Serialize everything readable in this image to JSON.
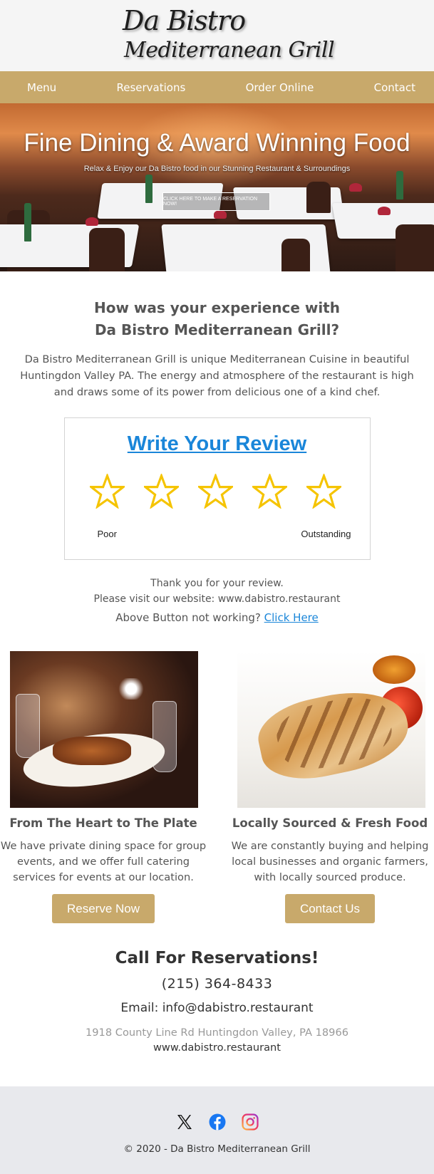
{
  "logo": {
    "line1": "Da Bistro",
    "line2": "Mediterranean Grill"
  },
  "nav": [
    {
      "label": "Menu"
    },
    {
      "label": "Reservations"
    },
    {
      "label": "Order Online"
    },
    {
      "label": "Contact"
    }
  ],
  "hero": {
    "title": "Fine Dining & Award Winning Food",
    "subtitle": "Relax & Enjoy our Da Bistro food in our Stunning Restaurant & Surroundings",
    "button_label": "CLICK HERE TO MAKE A RESERVATION NOW!"
  },
  "review": {
    "heading_line1": "How was your experience with",
    "heading_line2": "Da Bistro Mediterranean Grill?",
    "intro": "Da Bistro Mediterranean Grill is unique Mediterranean Cuisine in beautiful Huntingdon Valley PA. The energy and atmosphere of the restaurant is high and draws some of its power from delicious one of a kind chef.",
    "write_label": "Write Your Review",
    "star_count": 5,
    "low_label": "Poor",
    "high_label": "Outstanding",
    "thanks_line1": "Thank you for your review.",
    "thanks_line2": "Please visit our website: www.dabistro.restaurant",
    "not_working": "Above Button not working?",
    "click_here": "Click Here"
  },
  "features": [
    {
      "title": "From The Heart to The Plate",
      "text": "We have private dining space for group events, and we offer full catering services for events at our location.",
      "button_label": "Reserve Now"
    },
    {
      "title": "Locally Sourced & Fresh Food",
      "text": "We are constantly buying and helping local businesses and organic farmers, with locally sourced produce.",
      "button_label": "Contact Us"
    }
  ],
  "contact": {
    "heading": "Call For Reservations!",
    "phone": "(215) 364-8433",
    "email": "Email: info@dabistro.restaurant",
    "address": "1918 County Line Rd Huntingdon Valley, PA 18966",
    "website": "www.dabistro.restaurant"
  },
  "footer": {
    "socials": [
      "x-icon",
      "facebook-icon",
      "instagram-icon"
    ],
    "copyright": "© 2020 - Da Bistro Mediterranean Grill"
  },
  "colors": {
    "accent": "#c8a96b",
    "link": "#1a86d9",
    "star": "#f5c400",
    "footer_bg": "#e8e9ed"
  }
}
